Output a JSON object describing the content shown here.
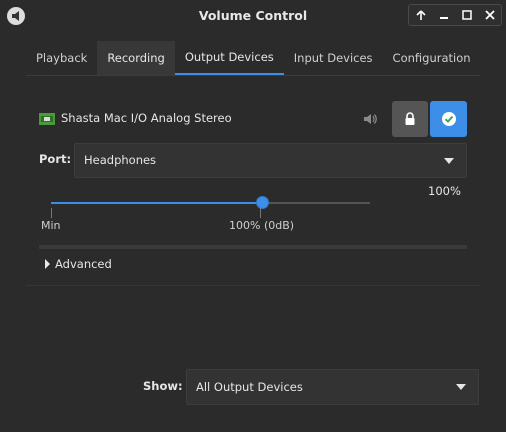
{
  "window": {
    "title": "Volume Control"
  },
  "tabs": [
    "Playback",
    "Recording",
    "Output Devices",
    "Input Devices",
    "Configuration"
  ],
  "active_tab": "Output Devices",
  "device": {
    "name": "Shasta Mac I/O Analog Stereo",
    "port_label": "Port:",
    "port_value": "Headphones",
    "volume_percent_label": "100%",
    "volume_fraction": 0.66,
    "min_label": "Min",
    "zero_db_label": "100% (0dB)",
    "locked": true,
    "is_default": true
  },
  "advanced_label": "Advanced",
  "show": {
    "label": "Show:",
    "value": "All Output Devices"
  },
  "colors": {
    "accent": "#3d8ee6",
    "background": "#2b2b2b",
    "lock_button": "#555555"
  }
}
